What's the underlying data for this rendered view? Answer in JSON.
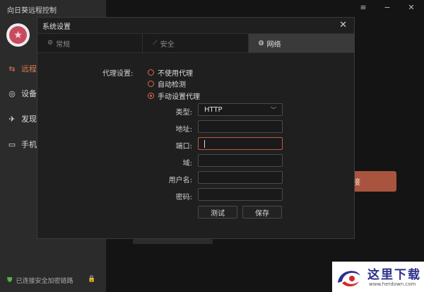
{
  "app": {
    "title": "向日葵远程控制",
    "nav": [
      {
        "label": "远程",
        "icon": "remote-icon",
        "active": true
      },
      {
        "label": "设备",
        "icon": "device-icon",
        "active": false
      },
      {
        "label": "发现",
        "icon": "discover-icon",
        "active": false
      },
      {
        "label": "手机",
        "icon": "monitor-icon",
        "active": false
      }
    ],
    "status_text": "已连接安全加密链路",
    "connect_label": "接"
  },
  "dialog": {
    "title": "系统设置",
    "tabs": [
      {
        "label": "常规",
        "icon": "gear-icon",
        "active": false
      },
      {
        "label": "安全",
        "icon": "wrench-icon",
        "active": false
      },
      {
        "label": "网络",
        "icon": "globe-icon",
        "active": true
      }
    ],
    "proxy_label": "代理设置:",
    "proxy_options": [
      {
        "label": "不使用代理",
        "checked": false
      },
      {
        "label": "自动检测",
        "checked": false
      },
      {
        "label": "手动设置代理",
        "checked": true
      }
    ],
    "fields": {
      "type_label": "类型:",
      "type_value": "HTTP",
      "address_label": "地址:",
      "port_label": "端口:",
      "domain_label": "域:",
      "username_label": "用户名:",
      "password_label": "密码:"
    },
    "test_label": "测试",
    "save_label": "保存"
  },
  "watermark": {
    "text": "这里下载",
    "url": "www.herdown.com"
  },
  "colors": {
    "accent": "#e06a4a",
    "connect": "#a8543e",
    "shield": "#52b14a"
  }
}
